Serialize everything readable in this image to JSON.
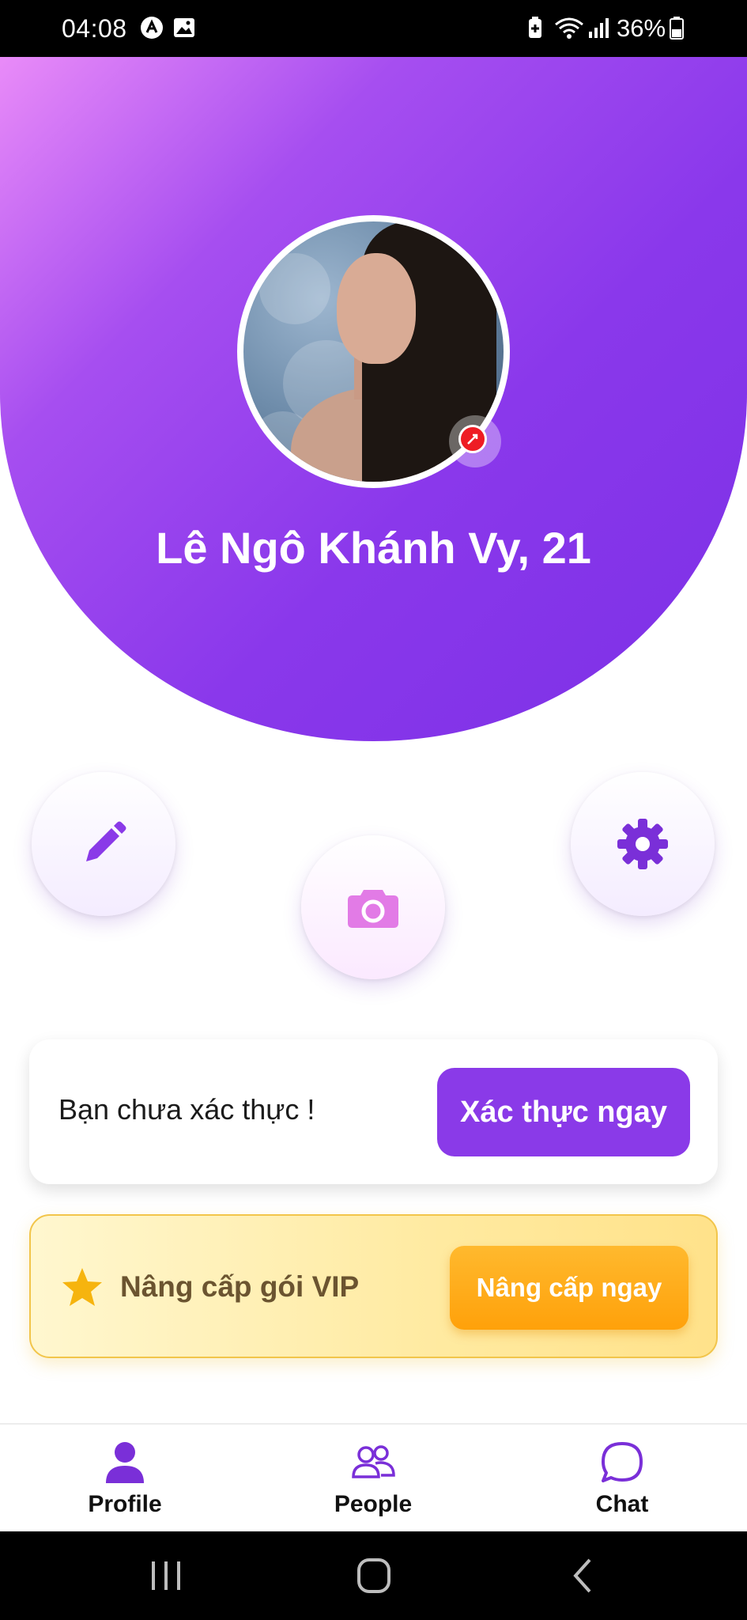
{
  "status_bar": {
    "time": "04:08",
    "battery": "36%",
    "icons": [
      "app-notification-icon",
      "image-icon",
      "battery-saver-icon",
      "wifi-icon",
      "signal-icon",
      "battery-icon"
    ]
  },
  "profile": {
    "name_age": "Lê Ngô Khánh Vy, 21",
    "avatar_badge": "unverified-badge-icon"
  },
  "actions": {
    "edit": "pencil-icon",
    "camera": "camera-icon",
    "settings": "gear-icon"
  },
  "verify": {
    "message": "Bạn chưa xác thực !",
    "button_label": "Xác thực ngay"
  },
  "vip": {
    "message": "Nâng cấp gói VIP",
    "button_label": "Nâng cấp ngay"
  },
  "bottom_nav": {
    "items": [
      {
        "label": "Profile",
        "icon": "person-icon",
        "active": true
      },
      {
        "label": "People",
        "icon": "people-icon",
        "active": false
      },
      {
        "label": "Chat",
        "icon": "chat-bubble-icon",
        "active": false
      }
    ]
  },
  "colors": {
    "primary": "#8a3ae8",
    "gradient_start": "#e98bf8",
    "gradient_end": "#7c30e6",
    "vip_button": "#ffa10a",
    "badge_red": "#ee1c24"
  }
}
